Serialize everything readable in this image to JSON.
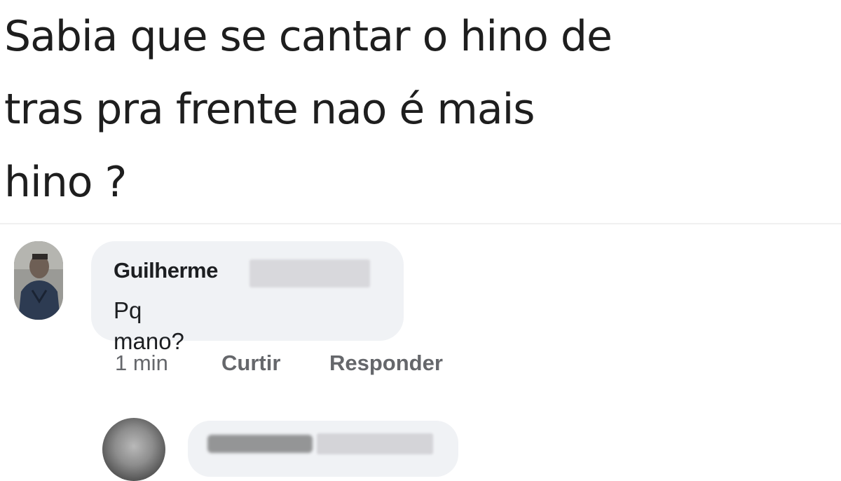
{
  "post": {
    "lines": [
      "Sabia que se cantar o hino de",
      "tras pra frente nao é mais",
      "hino ?"
    ]
  },
  "comment": {
    "author": "Guilherme",
    "text": "Pq mano?",
    "time": "1 min",
    "like_label": "Curtir",
    "reply_label": "Responder"
  },
  "colors": {
    "bubble": "#f0f2f5",
    "meta_text": "#65676b",
    "text": "#1c1e21"
  }
}
